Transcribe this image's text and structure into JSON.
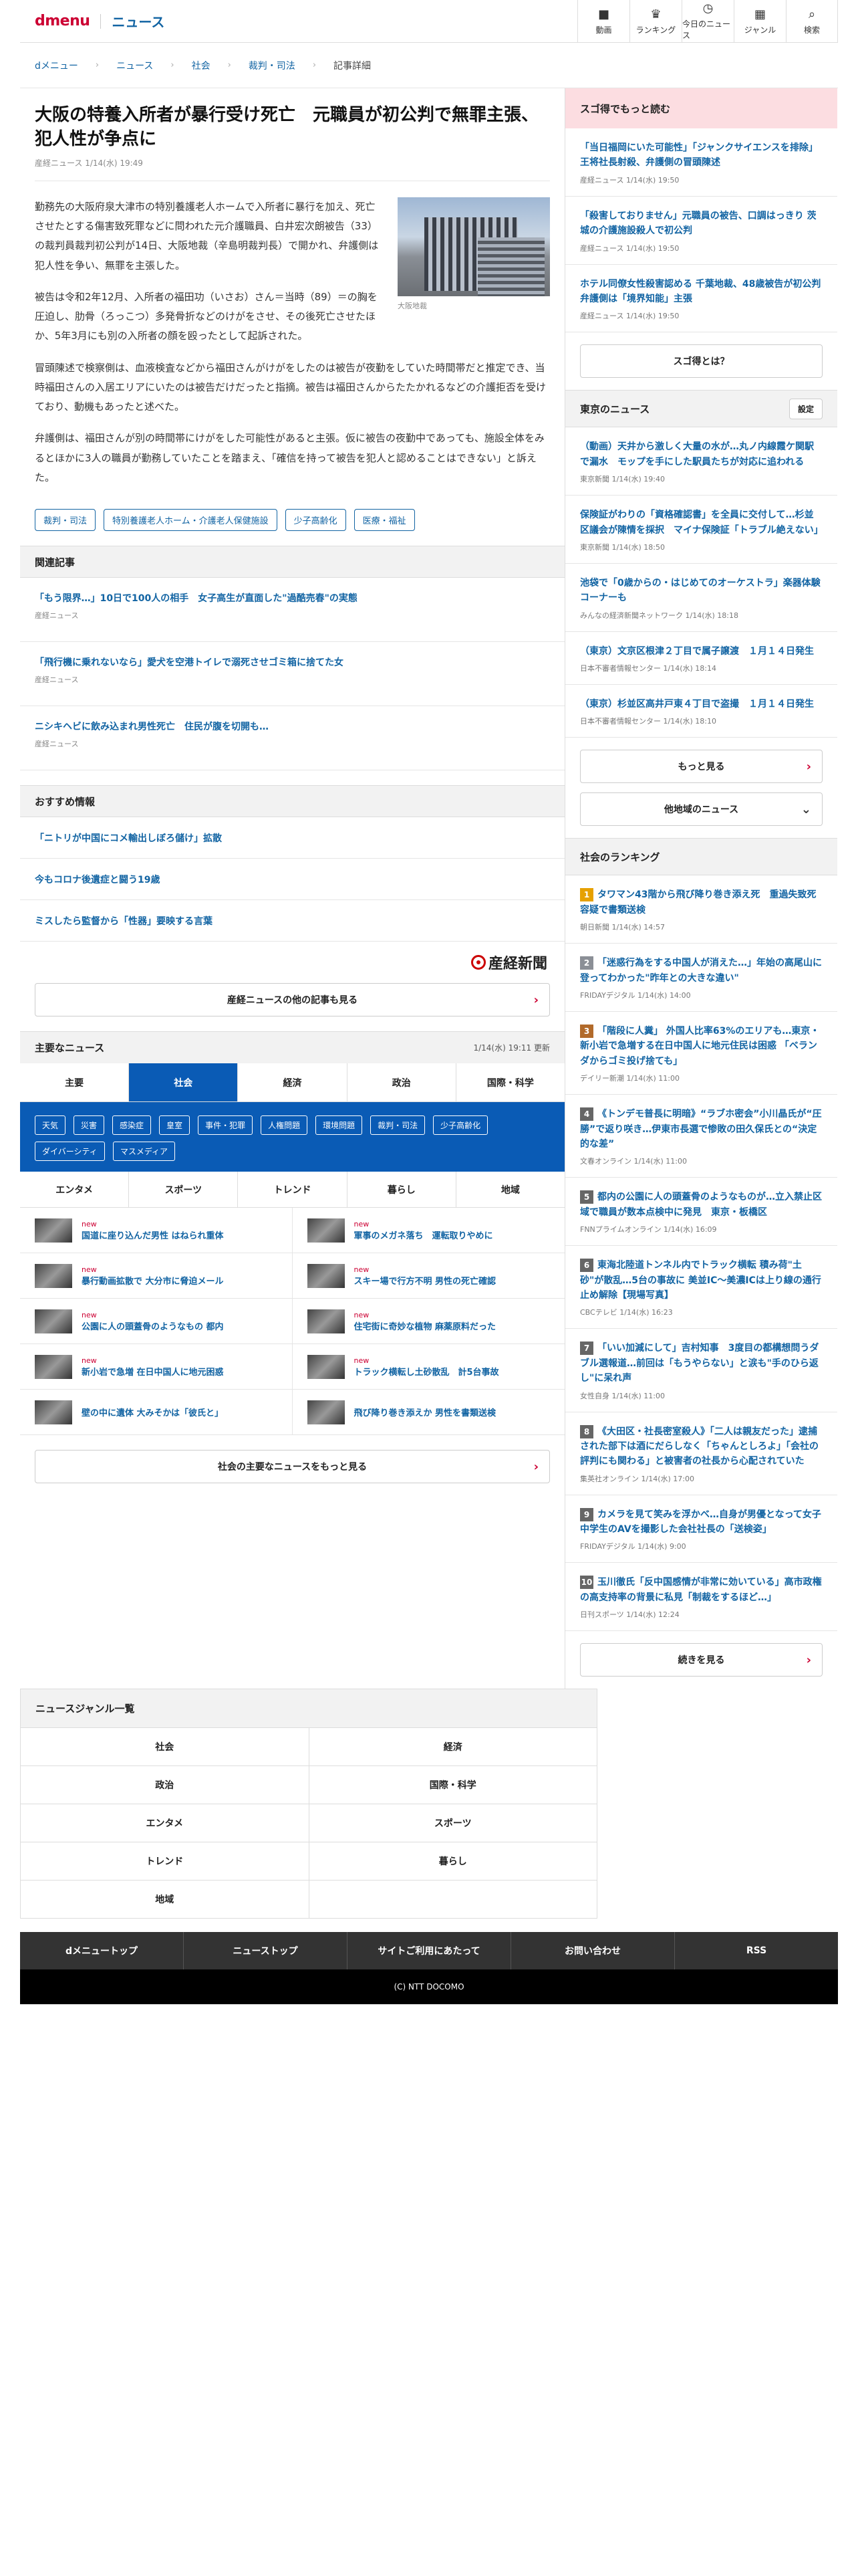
{
  "header": {
    "logo": "dmenu",
    "brand": "ニュース",
    "nav": [
      {
        "icon": "video-icon",
        "glyph": "■",
        "label": "動画"
      },
      {
        "icon": "trophy-icon",
        "glyph": "♛",
        "label": "ランキング"
      },
      {
        "icon": "clock-icon",
        "glyph": "◷",
        "label": "今日のニュース"
      },
      {
        "icon": "grid-icon",
        "glyph": "▦",
        "label": "ジャンル"
      },
      {
        "icon": "search-icon",
        "glyph": "⌕",
        "label": "検索"
      }
    ]
  },
  "breadcrumb": [
    "dメニュー",
    "ニュース",
    "社会",
    "裁判・司法",
    "記事詳細"
  ],
  "article": {
    "title": "大阪の特養入所者が暴行受け死亡　元職員が初公判で無罪主張、犯人性が争点に",
    "meta": "産経ニュース 1/14(水) 19:49",
    "photo_caption": "大阪地裁",
    "paragraphs": [
      "勤務先の大阪府泉大津市の特別養護老人ホームで入所者に暴行を加え、死亡させたとする傷害致死罪などに問われた元介護職員、白井宏次朗被告（33）の裁判員裁判初公判が14日、大阪地裁（辛島明裁判長）で開かれ、弁護側は犯人性を争い、無罪を主張した。",
      "被告は令和2年12月、入所者の福田功（いさお）さん＝当時（89）＝の胸を圧迫し、肋骨（ろっこつ）多発骨折などのけがをさせ、その後死亡させたほか、5年3月にも別の入所者の顔を殴ったとして起訴された。",
      "冒頭陳述で検察側は、血液検査などから福田さんがけがをしたのは被告が夜勤をしていた時間帯だと推定でき、当時福田さんの入居エリアにいたのは被告だけだったと指摘。被告は福田さんからたたかれるなどの介護拒否を受けており、動機もあったと述べた。",
      "弁護側は、福田さんが別の時間帯にけがをした可能性があると主張。仮に被告の夜勤中であっても、施設全体をみるとほかに3人の職員が勤務していたことを踏まえ、「確信を持って被告を犯人と認めることはできない」と訴えた。"
    ],
    "tags": [
      "裁判・司法",
      "特別養護老人ホーム・介護老人保健施設",
      "少子高齢化",
      "医療・福祉"
    ]
  },
  "related": {
    "heading": "関連記事",
    "items": [
      {
        "title": "「もう限界…」10日で100人の相手　女子高生が直面した\"過酷売春\"の実態",
        "source": "産経ニュース"
      },
      {
        "title": "「飛行機に乗れないなら」愛犬を空港トイレで溺死させゴミ箱に捨てた女",
        "source": "産経ニュース"
      },
      {
        "title": "ニシキヘビに飲み込まれ男性死亡　住民が腹を切開も…",
        "source": "産経ニュース"
      }
    ]
  },
  "recommended": {
    "heading": "おすすめ情報",
    "items": [
      "「ニトリが中国にコメ輸出しぼろ儲け」拡散",
      "今もコロナ後遺症と闘う19歳",
      "ミスしたら監督から「性器」要映する言葉"
    ],
    "logo_text": "産経新聞",
    "more_label": "産経ニュースの他の記事も見る"
  },
  "major": {
    "heading": "主要なニュース",
    "timestamp": "1/14(水) 19:11 更新",
    "tabs": [
      "主要",
      "社会",
      "経済",
      "政治",
      "国際・科学"
    ],
    "active_tab": "社会",
    "subtags": [
      "天気",
      "災害",
      "感染症",
      "皇室",
      "事件・犯罪",
      "人権問題",
      "環境問題",
      "裁判・司法",
      "少子高齢化",
      "ダイバーシティ",
      "マスメディア"
    ],
    "tabs2": [
      "エンタメ",
      "スポーツ",
      "トレンド",
      "暮らし",
      "地域"
    ],
    "new_label": "new",
    "items": [
      {
        "title": "国道に座り込んだ男性 はねられ重体",
        "new": true
      },
      {
        "title": "軍事のメガネ落ち　運転取りやめに",
        "new": true
      },
      {
        "title": "暴行動画拡散で 大分市に脅迫メール",
        "new": true
      },
      {
        "title": "スキー場で行方不明 男性の死亡確認",
        "new": true
      },
      {
        "title": "公園に人の頭蓋骨のようなもの 都内",
        "new": true
      },
      {
        "title": "住宅街に奇妙な植物 麻薬原料だった",
        "new": true
      },
      {
        "title": "新小岩で急増 在日中国人に地元困惑",
        "new": true
      },
      {
        "title": "トラック横転し土砂散乱　計5台事故",
        "new": true
      },
      {
        "title": "壁の中に遺体 大みそかは「彼氏と」",
        "new": false
      },
      {
        "title": "飛び降り巻き添えか 男性を書類送検",
        "new": false
      }
    ],
    "more_label": "社会の主要なニュースをもっと見る"
  },
  "sugoroku": {
    "heading": "スゴ得でもっと読む",
    "items": [
      {
        "title": "「当日福岡にいた可能性」「ジャンクサイエンスを排除」王将社長射殺、弁護側の冒頭陳述",
        "meta": "産経ニュース 1/14(水) 19:50"
      },
      {
        "title": "「殺害しておりません」元職員の被告、口調はっきり 茨城の介護施設殺人で初公判",
        "meta": "産経ニュース 1/14(水) 19:50"
      },
      {
        "title": "ホテル同僚女性殺害認める 千葉地裁、48歳被告が初公判 弁護側は「境界知能」主張",
        "meta": "産経ニュース 1/14(水) 19:50"
      }
    ],
    "about_label": "スゴ得とは？"
  },
  "tokyo": {
    "heading": "東京のニュース",
    "settings_label": "設定",
    "items": [
      {
        "title": "（動画）天井から激しく大量の水が…丸ノ内線霞ケ関駅で漏水　モップを手にした駅員たちが対応に追われる",
        "meta": "東京新聞 1/14(水) 19:40"
      },
      {
        "title": "保険証がわりの「資格確認書」を全員に交付して…杉並区議会が陳情を採択　マイナ保険証「トラブル絶えない」",
        "meta": "東京新聞 1/14(水) 18:50"
      },
      {
        "title": "池袋で「0歳からの・はじめてのオーケストラ」楽器体験コーナーも",
        "meta": "みんなの経済新聞ネットワーク 1/14(水) 18:18"
      },
      {
        "title": "（東京）文京区根津２丁目で属子譲渡　１月１４日発生",
        "meta": "日本不審者情報センター 1/14(水) 18:14"
      },
      {
        "title": "（東京）杉並区高井戸東４丁目で盗撮　１月１４日発生",
        "meta": "日本不審者情報センター 1/14(水) 18:10"
      }
    ],
    "more_label": "もっと見る",
    "other_label": "他地域のニュース"
  },
  "ranking": {
    "heading": "社会のランキング",
    "items": [
      {
        "rank": "1",
        "title": "タワマン43階から飛び降り巻き添え死　重過失致死容疑で書類送検",
        "meta": "朝日新聞 1/14(水) 14:57"
      },
      {
        "rank": "2",
        "title": "「迷惑行為をする中国人が消えた…」年始の高尾山に登ってわかった\"昨年との大きな違い\"",
        "meta": "FRIDAYデジタル 1/14(水) 14:00"
      },
      {
        "rank": "3",
        "title": "「階段に人糞」 外国人比率63%のエリアも…東京・新小岩で急増する在日中国人に地元住民は困惑 「ベランダからゴミ投げ捨ても」",
        "meta": "デイリー新潮 1/14(水) 11:00"
      },
      {
        "rank": "4",
        "title": "《トンデモ普長に明暗》“ラブホ密会”小川晶氏が“圧勝”で返り咲き…伊東市長選で惨敗の田久保氏との“決定的な差”",
        "meta": "文春オンライン 1/14(水) 11:00"
      },
      {
        "rank": "5",
        "title": "都内の公園に人の頭蓋骨のようなものが…立入禁止区域で職員が数本点検中に発見　東京・板橋区",
        "meta": "FNNプライムオンライン 1/14(水) 16:09"
      },
      {
        "rank": "6",
        "title": "東海北陸道トンネル内でトラック横転 積み荷\"土砂\"が散乱…5台の事故に 美並IC～美濃ICは上り線の通行止め解除【現場写真】",
        "meta": "CBCテレビ 1/14(水) 16:23"
      },
      {
        "rank": "7",
        "title": "「いい加減にして」吉村知事　3度目の都構想問うダブル選報道…前回は「もうやらない」と涙も\"手のひら返し\"に呆れ声",
        "meta": "女性自身 1/14(水) 11:00"
      },
      {
        "rank": "8",
        "title": "《大田区・社長密室殺人》「二人は親友だった」逮捕された部下は酒にだらしなく「ちゃんとしろよ」「会社の評判にも関わる」と被害者の社長から心配されていた",
        "meta": "集英社オンライン 1/14(水) 17:00"
      },
      {
        "rank": "9",
        "title": "カメラを見て笑みを浮かべ…自身が男優となって女子中学生のAVを撮影した会社社長の「送検姿」",
        "meta": "FRIDAYデジタル 1/14(水) 9:00"
      },
      {
        "rank": "10",
        "title": "玉川徹氏「反中国感情が非常に効いている」高市政権の高支持率の背景に私見「制裁をするほど…」",
        "meta": "日刊スポーツ 1/14(水) 12:24"
      }
    ],
    "more_label": "続きを見る"
  },
  "genres": {
    "heading": "ニュースジャンル一覧",
    "items": [
      "社会",
      "経済",
      "政治",
      "国際・科学",
      "エンタメ",
      "スポーツ",
      "トレンド",
      "暮らし",
      "地域"
    ]
  },
  "footer": {
    "nav": [
      "dメニュートップ",
      "ニューストップ",
      "サイトご利用にあたって",
      "お問い合わせ",
      "RSS"
    ],
    "copyright": "(C) NTT DOCOMO"
  }
}
